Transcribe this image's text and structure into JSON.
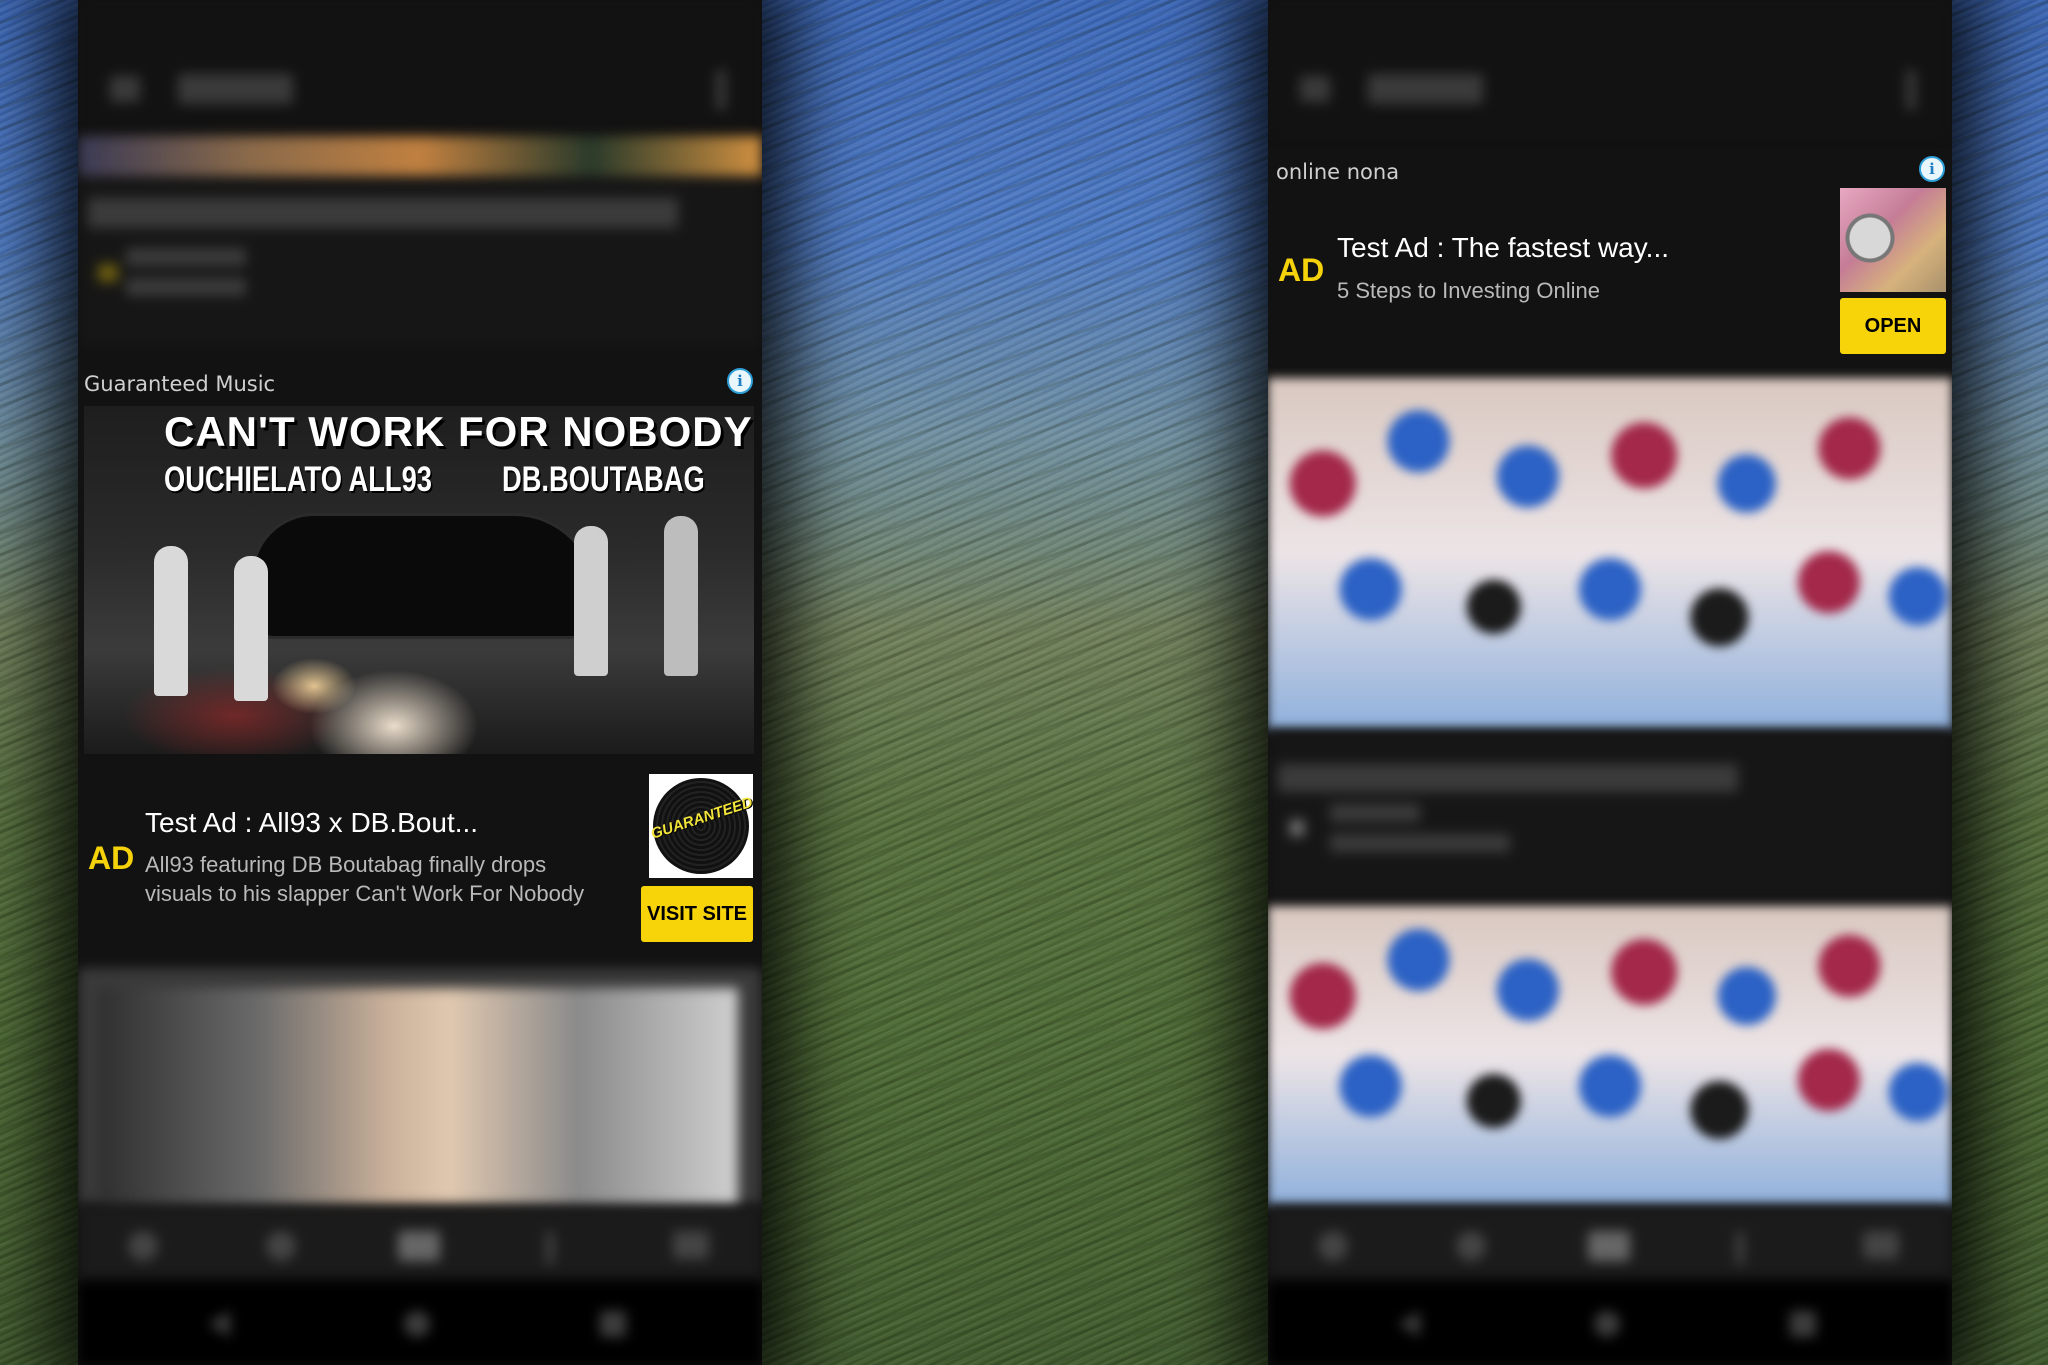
{
  "left_screen": {
    "ad": {
      "sponsor": "Guaranteed Music",
      "media_title_line1": "CAN'T WORK FOR NOBODY",
      "media_artist_left": "OUCHIELATO ALL93",
      "media_artist_right": "DB.BOUTABAG",
      "badge": "AD",
      "title": "Test Ad : All93 x DB.Bout...",
      "description_line1": "All93 featuring DB Boutabag finally drops",
      "description_line2": "visuals to his slapper Can't Work For Nobody",
      "logo_text": "GUARANTEED",
      "cta": "VISIT SITE"
    }
  },
  "right_screen": {
    "ad": {
      "sponsor": "online nona",
      "badge": "AD",
      "title": "Test Ad : The fastest way...",
      "description": "5 Steps to Investing Online",
      "cta": "OPEN"
    }
  },
  "colors": {
    "ad_badge": "#f5d20a",
    "cta_background": "#f7d40a",
    "info_icon": "#2f9fd8",
    "card_background": "#121212"
  },
  "icons": [
    "menu-icon",
    "overflow-icon",
    "info-icon",
    "search-icon",
    "refresh-icon",
    "mail-icon",
    "back-icon",
    "home-icon",
    "recents-icon"
  ]
}
